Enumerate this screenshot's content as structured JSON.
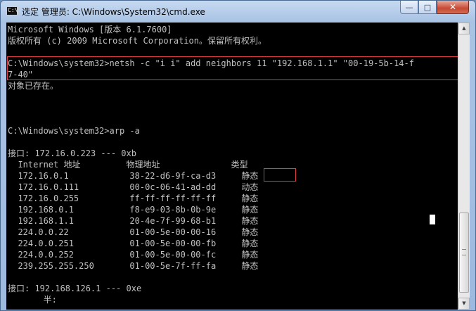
{
  "window": {
    "title": "选定 管理员: C:\\Windows\\System32\\cmd.exe",
    "icon": "cmd-icon",
    "controls": {
      "minimize": "—",
      "maximize": "□",
      "close": "✕"
    }
  },
  "console": {
    "lines": [
      "Microsoft Windows [版本 6.1.7600]",
      "版权所有 (c) 2009 Microsoft Corporation。保留所有权利。",
      "",
      "C:\\Windows\\system32>netsh -c \"i i\" add neighbors 11 \"192.168.1.1\" \"00-19-5b-14-f",
      "7-40\"",
      "对象已存在。",
      "",
      "",
      "",
      "C:\\Windows\\system32>arp -a",
      "",
      "接口: 172.16.0.223 --- 0xb",
      "  Internet 地址         物理地址              类型",
      "  172.16.0.1            38-22-d6-9f-ca-d3     静态",
      "  172.16.0.111          00-0c-06-41-ad-dd     动态",
      "  172.16.0.255          ff-ff-ff-ff-ff-ff     静态",
      "  192.168.0.1           f8-e9-03-8b-0b-9e     静态",
      "  192.168.1.1           20-4e-7f-99-68-b1     静态",
      "  224.0.0.22            01-00-5e-00-00-16     静态",
      "  224.0.0.251           01-00-5e-00-00-fb     静态",
      "  224.0.0.252           01-00-5e-00-00-fc     静态",
      "  239.255.255.250       01-00-5e-7f-ff-fa     静态",
      "",
      "接口: 192.168.126.1 --- 0xe",
      "       半:"
    ]
  },
  "colors": {
    "highlight_border": "#e03a3a",
    "console_bg": "#000000",
    "console_fg": "#c0c0c0"
  }
}
